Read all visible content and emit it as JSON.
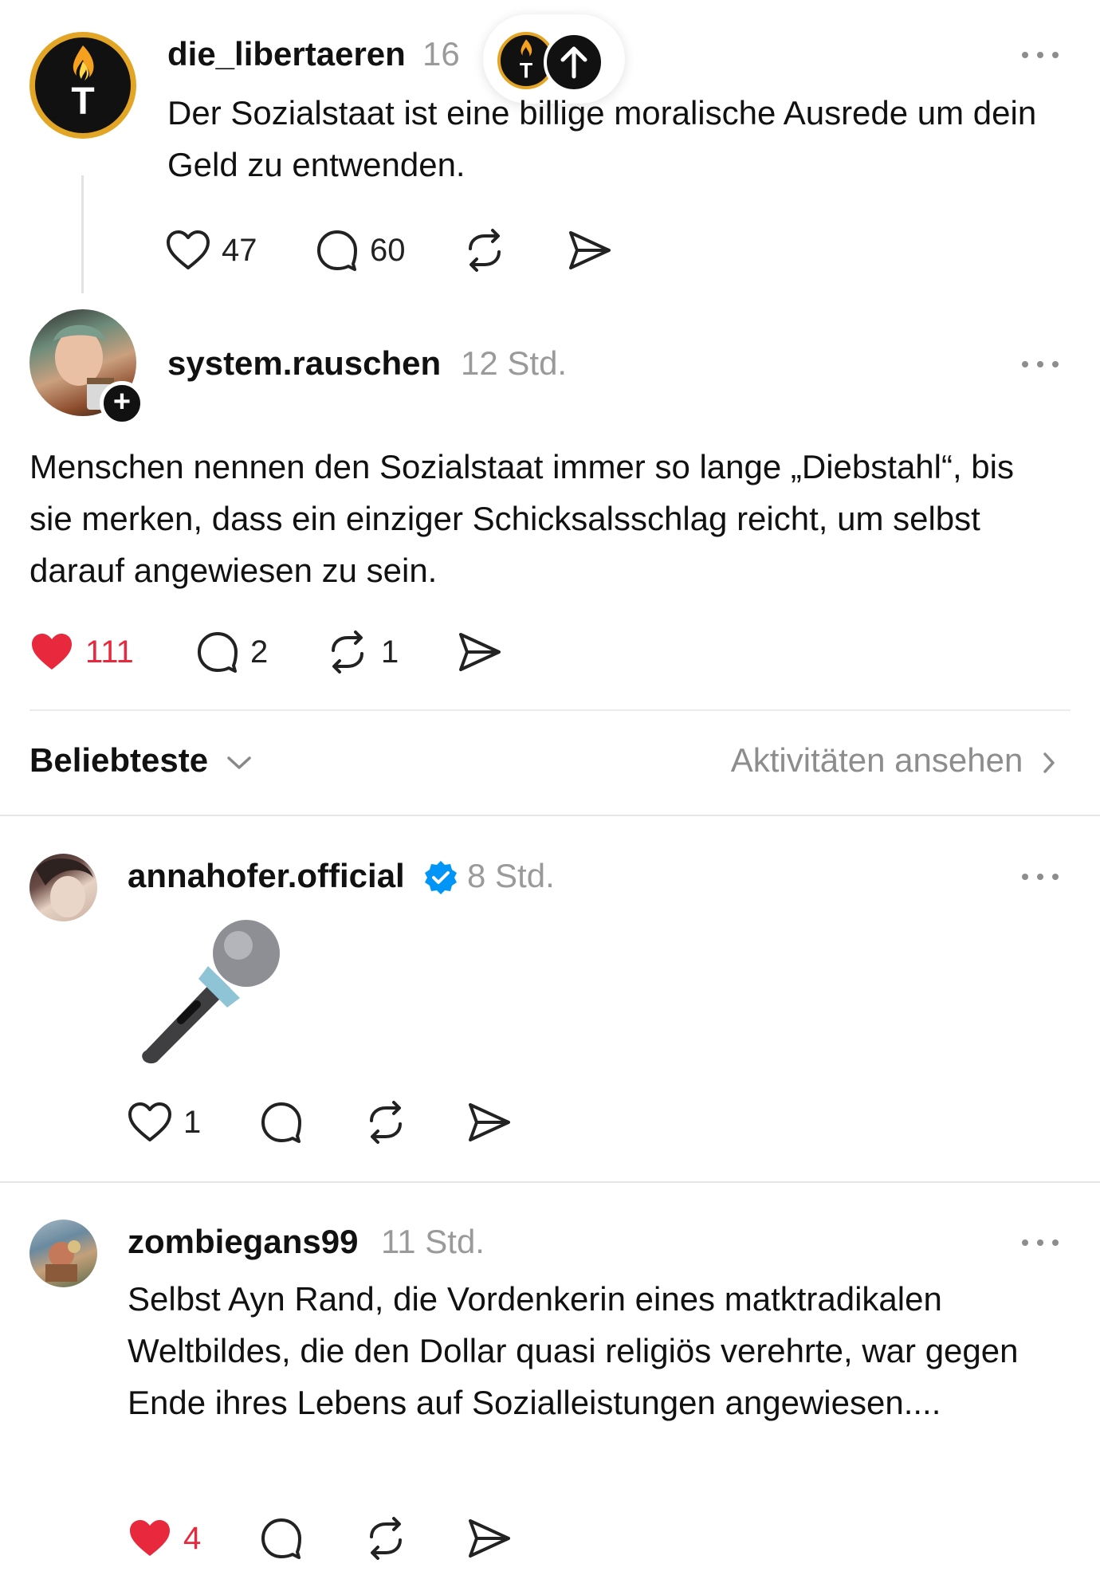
{
  "posts": [
    {
      "username": "die_libertaeren",
      "time": "16",
      "text": "Der Sozialstaat ist eine billige moralische Ausrede um dein Geld zu entwenden.",
      "likes": "47",
      "comments": "60",
      "reposts": "",
      "liked": false
    },
    {
      "username": "system.rauschen",
      "time": "12 Std.",
      "text": "Menschen nennen den Sozialstaat immer so lange „Diebstahl“, bis sie merken, dass ein einziger Schicksalsschlag reicht, um selbst darauf angewiesen zu sein.",
      "likes": "111",
      "comments": "2",
      "reposts": "1",
      "liked": true
    }
  ],
  "sort": {
    "label": "Beliebteste",
    "activity_link": "Aktivitäten ansehen"
  },
  "replies": [
    {
      "username": "annahofer.official",
      "verified": true,
      "time": "8 Std.",
      "content_icon": "microphone-emoji",
      "likes": "1",
      "liked": false
    },
    {
      "username": "zombiegans99",
      "verified": false,
      "time": "11 Std.",
      "text": "Selbst Ayn Rand, die Vordenkerin eines matktradikalen Weltbildes, die den Dollar quasi religiös verehrte, war gegen Ende ihres Lebens auf Sozialleistungen angewiesen....",
      "likes": "4",
      "liked": true
    }
  ],
  "colors": {
    "like_active": "#e8283c",
    "verified": "#0095f6",
    "muted_text": "#9a9a9a",
    "avatar_ring": "#e3a526"
  }
}
